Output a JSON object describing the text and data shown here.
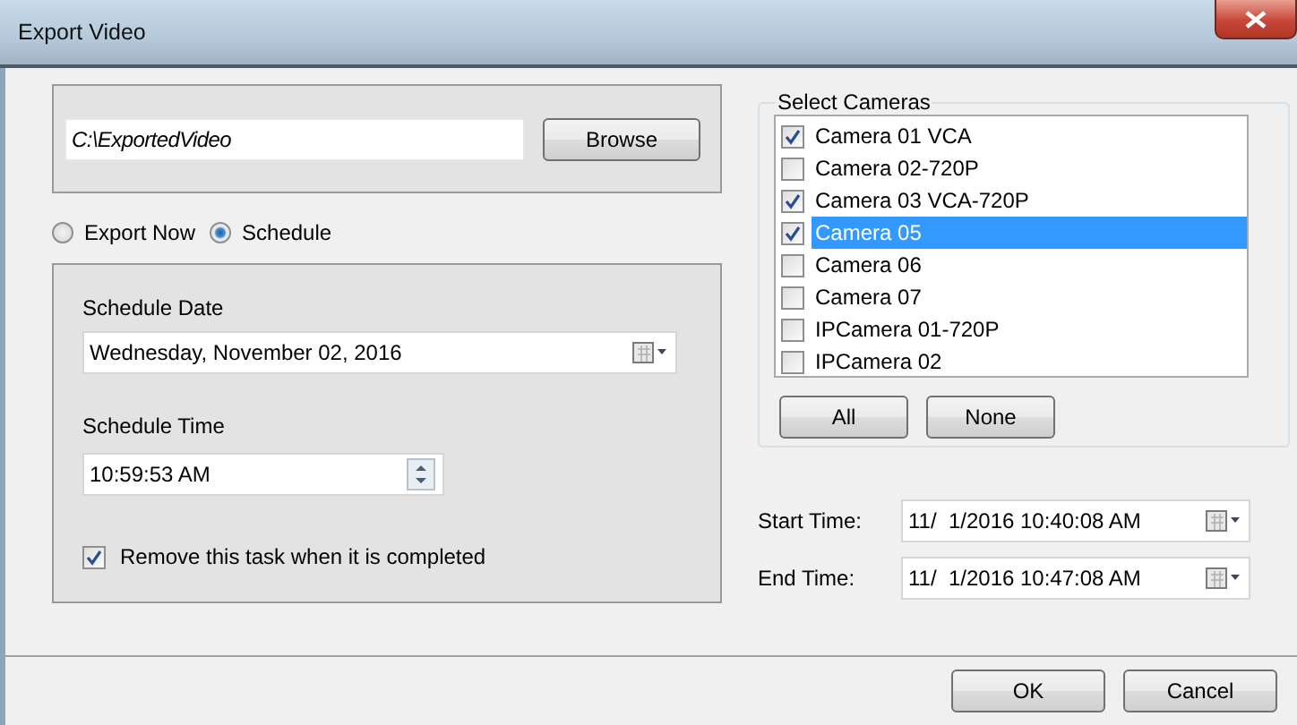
{
  "window": {
    "title": "Export Video"
  },
  "export_path": {
    "value": "C:\\ExportedVideo",
    "button": "Browse"
  },
  "export_mode": [
    {
      "label": "Export Now",
      "selected": false
    },
    {
      "label": "Schedule",
      "selected": true
    }
  ],
  "schedule": {
    "date_label": "Schedule Date",
    "date": "Wednesday, November 02, 2016",
    "time_label": "Schedule Time",
    "time": "10:59:53 AM",
    "remove_task": {
      "label": "Remove this task when it is completed",
      "checked": true
    }
  },
  "cameras": {
    "title": "Select Cameras",
    "items": [
      {
        "label": "Camera 01 VCA",
        "checked": true,
        "selected": false
      },
      {
        "label": "Camera 02-720P",
        "checked": false,
        "selected": false
      },
      {
        "label": "Camera 03 VCA-720P",
        "checked": true,
        "selected": false
      },
      {
        "label": "Camera 05",
        "checked": true,
        "selected": true
      },
      {
        "label": "Camera 06",
        "checked": false,
        "selected": false
      },
      {
        "label": "Camera 07",
        "checked": false,
        "selected": false
      },
      {
        "label": "IPCamera 01-720P",
        "checked": false,
        "selected": false
      },
      {
        "label": "IPCamera 02",
        "checked": false,
        "selected": false
      }
    ],
    "buttons": [
      "All",
      "None"
    ]
  },
  "times": [
    {
      "label": "Start Time:",
      "value": "11/  1/2016 10:40:08 AM"
    },
    {
      "label": "End Time:",
      "value": "11/  1/2016 10:47:08 AM"
    }
  ],
  "buttons": [
    "OK",
    "Cancel"
  ]
}
